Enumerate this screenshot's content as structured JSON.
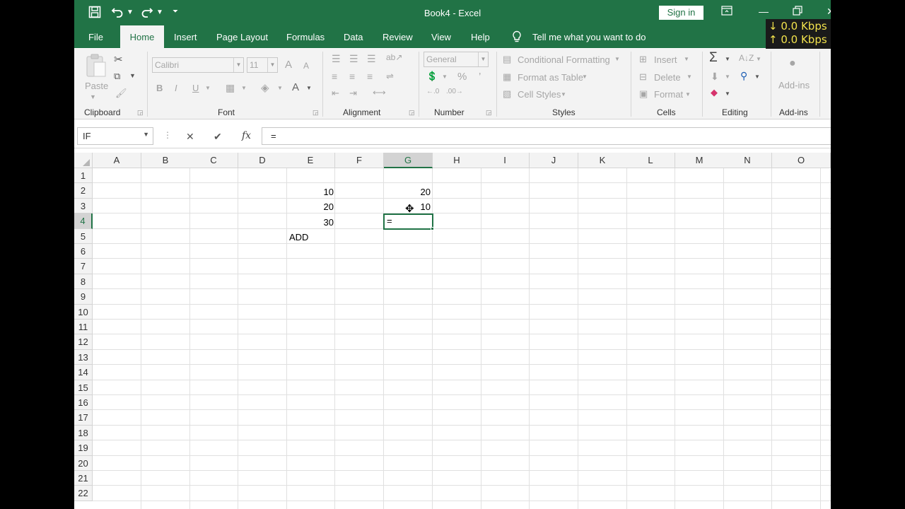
{
  "titlebar": {
    "title": "Book4  -  Excel",
    "sign_in": "Sign in",
    "save_icon": "save-icon",
    "undo_icon": "undo-icon",
    "redo_icon": "redo-icon"
  },
  "network": {
    "down": "↓ 0.0 Kbps",
    "up": "↑ 0.0 Kbps"
  },
  "menu": {
    "tabs": [
      "File",
      "Home",
      "Insert",
      "Page Layout",
      "Formulas",
      "Data",
      "Review",
      "View",
      "Help"
    ],
    "tell_me": "Tell me what you want to do"
  },
  "ribbon": {
    "clipboard": {
      "label": "Clipboard",
      "paste": "Paste"
    },
    "font": {
      "label": "Font",
      "name": "Calibri",
      "size": "11",
      "bold": "B",
      "italic": "I",
      "underline": "U",
      "grow": "A",
      "shrink": "A",
      "color": "A"
    },
    "alignment": {
      "label": "Alignment"
    },
    "number": {
      "label": "Number",
      "format": "General",
      "percent": "%",
      "comma": "’"
    },
    "styles": {
      "label": "Styles",
      "conditional": "Conditional Formatting",
      "format_table": "Format as Table",
      "cell_styles": "Cell Styles"
    },
    "cells": {
      "label": "Cells",
      "insert": "Insert",
      "delete": "Delete",
      "format": "Format"
    },
    "editing": {
      "label": "Editing",
      "sum": "Σ"
    },
    "addins": {
      "label": "Add-ins",
      "button": "Add-ins"
    }
  },
  "formula_bar": {
    "name_box": "IF",
    "cancel": "✕",
    "enter": "✔",
    "fx": "fx",
    "formula": "="
  },
  "sheet": {
    "columns": [
      "A",
      "B",
      "C",
      "D",
      "E",
      "F",
      "G",
      "H",
      "I",
      "J",
      "K",
      "L",
      "M",
      "N",
      "O"
    ],
    "rows": [
      "1",
      "2",
      "3",
      "4",
      "5",
      "6",
      "7",
      "8",
      "9",
      "10",
      "11",
      "12",
      "13",
      "14",
      "15",
      "16",
      "17",
      "18",
      "19",
      "20",
      "21",
      "22"
    ],
    "selected_column": "G",
    "selected_row": "4",
    "cells": {
      "E2": "10",
      "G2": "20",
      "E3": "20",
      "G3": "10",
      "E4": "30",
      "E5": "ADD"
    },
    "active_cell": {
      "ref": "G4",
      "content": "="
    }
  }
}
